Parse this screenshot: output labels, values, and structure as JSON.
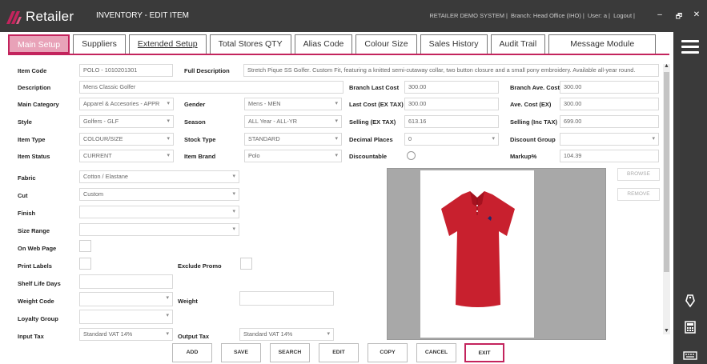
{
  "app": {
    "logo_text": "Retailer",
    "title": "INVENTORY - EDIT ITEM",
    "system": "RETAILER DEMO SYSTEM",
    "branch": "Branch: Head Office (IHO)",
    "user": "User: a",
    "logout": "Logout"
  },
  "window": {
    "minimize": "–",
    "restore": "🗗",
    "close": "✕"
  },
  "tabs": [
    {
      "label": "Main Setup"
    },
    {
      "label": "Suppliers"
    },
    {
      "label": "Extended Setup"
    },
    {
      "label": "Total Stores QTY"
    },
    {
      "label": "Alias Code"
    },
    {
      "label": "Colour Size"
    },
    {
      "label": "Sales History"
    },
    {
      "label": "Audit Trail"
    },
    {
      "label": "Message Module"
    }
  ],
  "labels": {
    "item_code": "Item Code",
    "full_description": "Full Description",
    "description": "Description",
    "main_category": "Main Category",
    "gender": "Gender",
    "style": "Style",
    "season": "Season",
    "item_type": "Item Type",
    "stock_type": "Stock Type",
    "item_status": "Item Status",
    "item_brand": "Item Brand",
    "branch_last_cost": "Branch Last Cost",
    "branch_ave_cost": "Branch Ave. Cost",
    "last_cost_ex": "Last Cost (EX TAX)",
    "ave_cost_ex": "Ave. Cost (EX)",
    "selling_ex": "Selling (EX TAX)",
    "selling_inc": "Selling (Inc TAX)",
    "decimal_places": "Decimal Places",
    "discount_group": "Discount Group",
    "discountable": "Discountable",
    "markup": "Markup%",
    "fabric": "Fabric",
    "cut": "Cut",
    "finish": "Finish",
    "size_range": "Size Range",
    "on_web_page": "On Web Page",
    "print_labels": "Print Labels",
    "exclude_promo": "Exclude Promo",
    "shelf_life_days": "Shelf Life Days",
    "weight_code": "Weight Code",
    "weight": "Weight",
    "loyalty_group": "Loyalty Group",
    "input_tax": "Input Tax",
    "output_tax": "Output Tax"
  },
  "values": {
    "item_code": "POLO - 1010201301",
    "full_description": "Stretch Pique SS Golfer. Custom Fit, featuring a knitted semi-cutaway collar, two button closure and a small pony embroidery. Available all-year round.",
    "description": "Mens Classic Golfer",
    "main_category": "Apparel & Accesories - APPR",
    "gender": "Mens - MEN",
    "style": "Golfers - GLF",
    "season": "ALL Year - ALL-YR",
    "item_type": "COLOUR/SIZE",
    "stock_type": "STANDARD",
    "item_status": "CURRENT",
    "item_brand": "Polo",
    "branch_last_cost": "300.00",
    "branch_ave_cost": "300.00",
    "last_cost_ex": "300.00",
    "ave_cost_ex": "300.00",
    "selling_ex": "613.16",
    "selling_inc": "699.00",
    "decimal_places": "0",
    "discount_group": "",
    "markup": "104.39",
    "fabric": "Cotton / Elastane",
    "cut": "Custom",
    "finish": "",
    "size_range": "",
    "shelf_life_days": "",
    "weight_code": "",
    "weight": "",
    "loyalty_group": "",
    "input_tax": "Standard VAT 14%",
    "output_tax": "Standard VAT 14%"
  },
  "image_buttons": {
    "browse": "BROWSE",
    "remove": "REMOVE"
  },
  "actions": [
    "ADD",
    "SAVE",
    "SEARCH",
    "EDIT",
    "COPY",
    "CANCEL",
    "EXIT"
  ],
  "colors": {
    "accent": "#c3245d",
    "titlebar": "#3a3a3a",
    "shirt": "#c8202e"
  }
}
